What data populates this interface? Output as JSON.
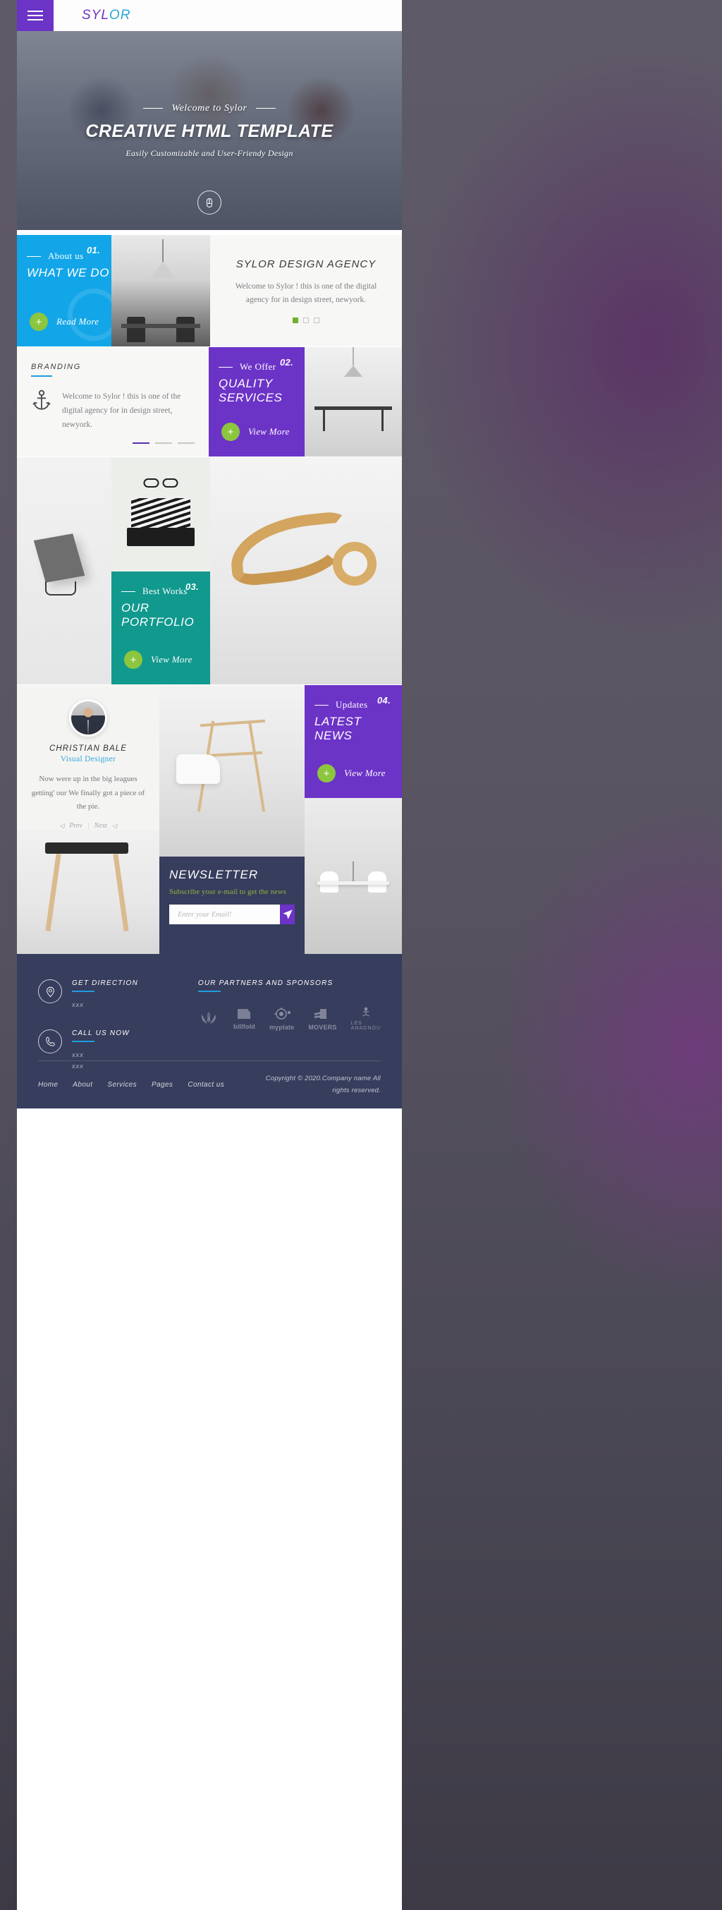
{
  "header": {
    "brand_part1": "SYL",
    "brand_part2": "OR",
    "menu_icon": "hamburger-icon",
    "search_icon": "search-icon",
    "cart_icon": "shopping-cart-icon"
  },
  "hero": {
    "kicker": "Welcome to Sylor",
    "title": "CREATIVE HTML TEMPLATE",
    "subtitle": "Easily Customizable and User-Friendy Design",
    "scroll_icon": "mouse-scroll-icon"
  },
  "about": {
    "category": "About us",
    "number": "01.",
    "title": "WHAT WE DO",
    "cta": "Read More",
    "agency_title": "SYLOR DESIGN AGENCY",
    "agency_desc": "Welcome to Sylor ! this is one of the digital agency for in design street, newyork.",
    "dots": [
      "on",
      "off",
      "off"
    ]
  },
  "branding": {
    "heading": "BRANDING",
    "icon": "anchor-icon",
    "text": "Welcome to Sylor ! this is one of the digital agency for in design street, newyork."
  },
  "services": {
    "category": "We Offer",
    "number": "02.",
    "title": "QUALITY SERVICES",
    "cta": "View More"
  },
  "portfolio": {
    "category": "Best Works",
    "number": "03.",
    "title": "OUR PORTFOLIO",
    "cta": "View More"
  },
  "testimonial": {
    "name": "CHRISTIAN BALE",
    "role": "Visual Designer",
    "quote": "Now were up in the big leagues getting' our We finally got a piece of the pie.",
    "prev": "Prev",
    "next": "Next",
    "separator": "|"
  },
  "news": {
    "category": "Updates",
    "number": "04.",
    "title": "LATEST NEWS",
    "cta": "View More"
  },
  "newsletter": {
    "title": "NEWSLETTER",
    "subtitle": "Subscribe your e-mail to get the news",
    "placeholder": "Enter your Email!",
    "submit_icon": "paper-plane-icon"
  },
  "footer": {
    "direction_heading": "GET DIRECTION",
    "direction_icon": "location-pin-icon",
    "direction_value": "xxx",
    "call_heading": "CALL US NOW",
    "call_icon": "phone-icon",
    "call_value_1": "xxx",
    "call_value_2": "xxx",
    "partners_heading": "OUR PARTNERS AND SPONSORS",
    "partners": [
      {
        "name": "wreath-laurel-logo",
        "label": ""
      },
      {
        "name": "billfold-logo",
        "label": "billfold"
      },
      {
        "name": "myplate-logo",
        "label": "myplate"
      },
      {
        "name": "movers-logo",
        "label": "MOVERS"
      },
      {
        "name": "les-anagnou-logo",
        "label": "LES ANAGNOU"
      }
    ],
    "nav": [
      "Home",
      "About",
      "Services",
      "Pages",
      "Contact us"
    ],
    "copyright": "Copyright © 2020.Company name All rights reserved."
  },
  "colors": {
    "purple": "#6c33c7",
    "blue": "#12a6e8",
    "teal": "#11998e",
    "green": "#8cc63e",
    "navy": "#373d5c",
    "accent_blue": "#1e9ee0"
  }
}
